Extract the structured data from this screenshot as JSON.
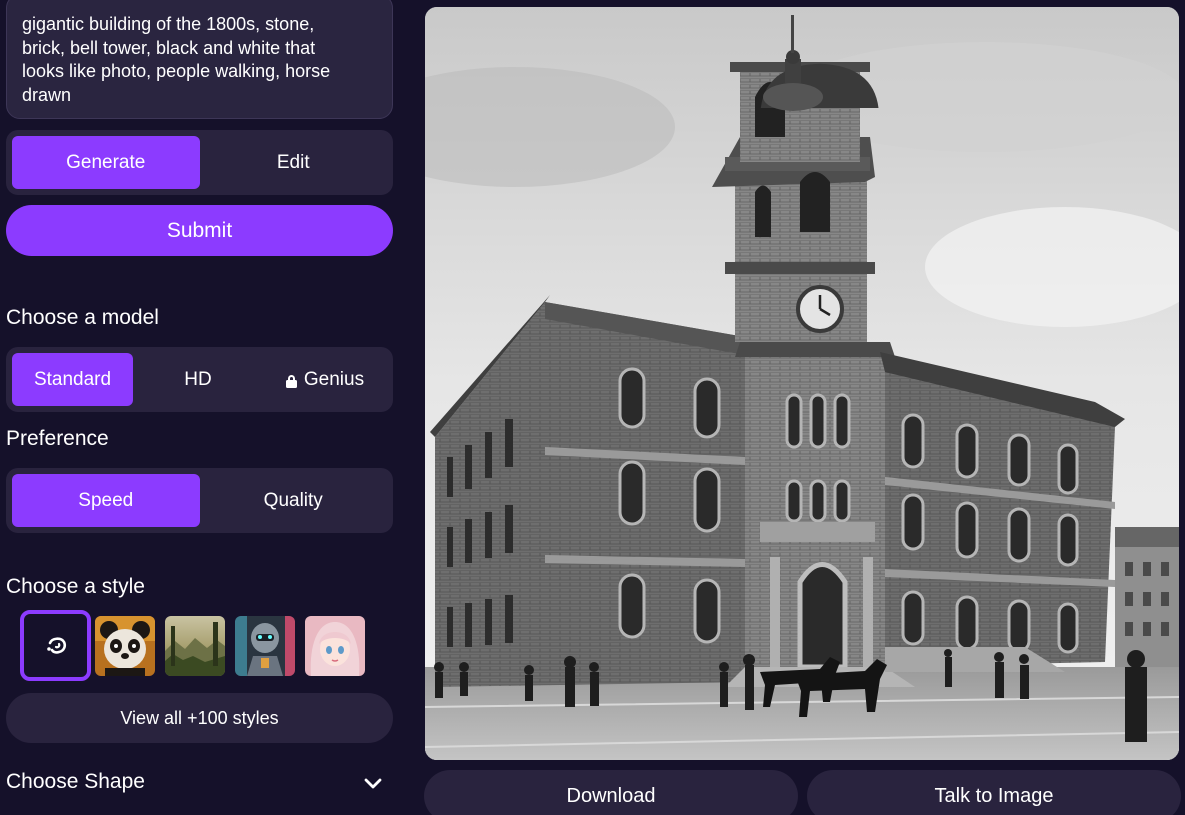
{
  "prompt": {
    "text": "gigantic building of the 1800s, stone,\nbrick, bell tower, black and white that\nlooks like photo, people walking, horse\ndrawn"
  },
  "mode": {
    "options": [
      "Generate",
      "Edit"
    ],
    "selected": "Generate"
  },
  "submit_label": "Submit",
  "model": {
    "heading": "Choose a model",
    "options": [
      "Standard",
      "HD",
      "Genius"
    ],
    "selected": "Standard",
    "locked": "Genius"
  },
  "preference": {
    "heading": "Preference",
    "options": [
      "Speed",
      "Quality"
    ],
    "selected": "Speed"
  },
  "style": {
    "heading": "Choose a style",
    "thumbnails": [
      "no-style-icon",
      "panda-style",
      "landscape-style",
      "robot-style",
      "anime-girl-style"
    ],
    "selected": "no-style-icon",
    "view_all_label": "View all +100 styles"
  },
  "shape": {
    "heading": "Choose Shape",
    "expand_icon": "chevron-down-icon"
  },
  "actions": {
    "download_label": "Download",
    "talk_label": "Talk to Image"
  },
  "colors": {
    "background": "#15112a",
    "panel": "#29233e",
    "accent": "#8c3bff"
  }
}
